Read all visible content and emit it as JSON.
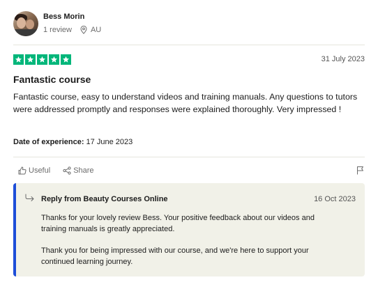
{
  "reviewer": {
    "name": "Bess Morin",
    "review_count": "1 review",
    "country": "AU"
  },
  "review": {
    "rating": 5,
    "date": "31 July 2023",
    "title": "Fantastic course",
    "body": "Fantastic course, easy to understand videos and training manuals. Any questions to tutors were addressed promptly and responses were explained thoroughly. Very impressed !",
    "experience_label": "Date of experience:",
    "experience_date": "17 June 2023"
  },
  "actions": {
    "useful_label": "Useful",
    "share_label": "Share"
  },
  "reply": {
    "from": "Reply from Beauty Courses Online",
    "date": "16 Oct 2023",
    "paragraph1": "Thanks for your lovely review Bess. Your positive feedback about our videos and training manuals is greatly appreciated.",
    "paragraph2": "Thank you for being impressed with our course, and we're here to support your continued learning journey."
  },
  "colors": {
    "star_green": "#00b67a",
    "reply_accent": "#1d4ed8",
    "reply_background": "#f1f1e8"
  }
}
